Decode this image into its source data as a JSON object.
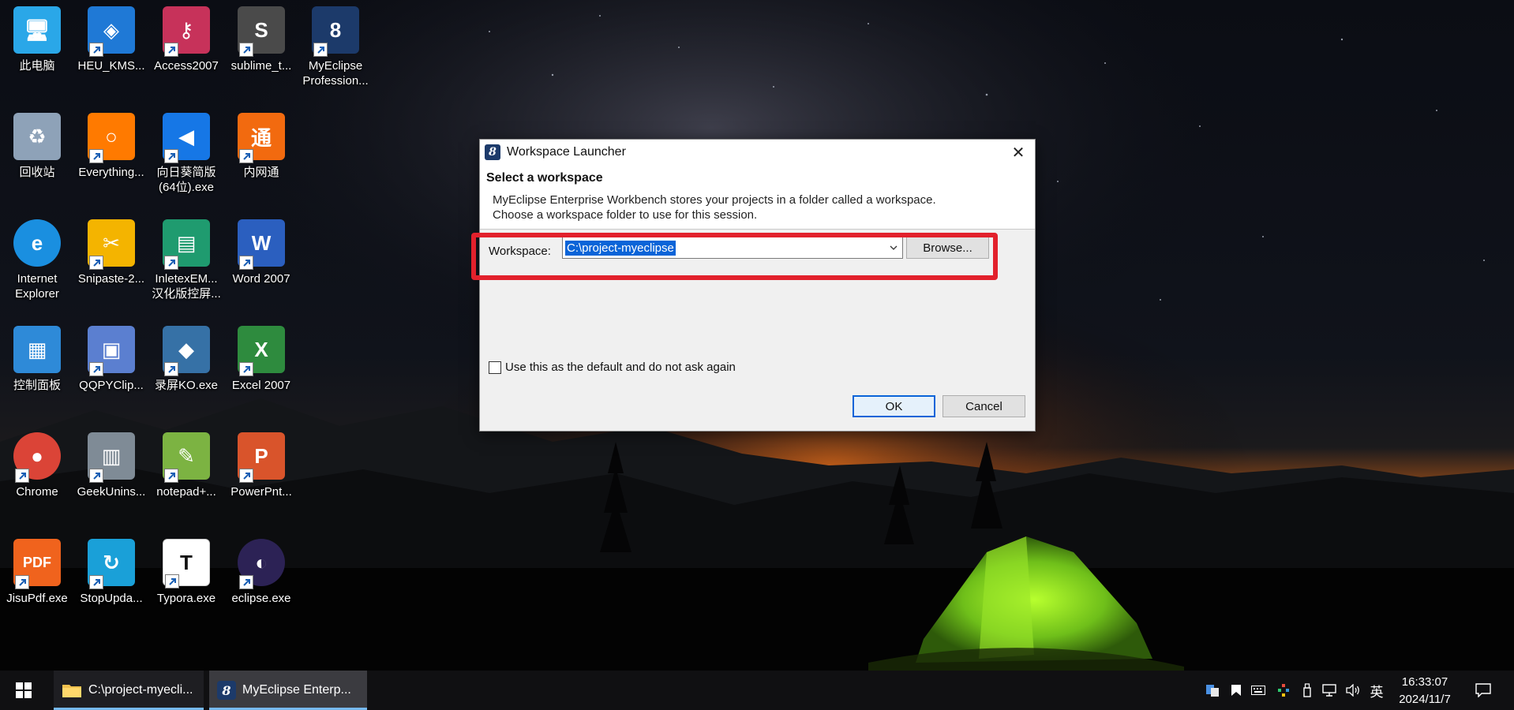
{
  "desktop": {
    "icons": [
      {
        "label": "此电脑",
        "icon": "computer-icon",
        "color": "#2aa7e8"
      },
      {
        "label": "HEU_KMS...",
        "icon": "cube-icon",
        "color": "#1f79d6"
      },
      {
        "label": "Access2007",
        "icon": "key-icon",
        "color": "#c7325a"
      },
      {
        "label": "sublime_t...",
        "icon": "sublime-icon",
        "color": "#4a4a4a"
      },
      {
        "label": "MyEclipse\nProfession...",
        "icon": "myeclipse-icon",
        "color": "#1c3a6a"
      },
      {
        "label": "回收站",
        "icon": "recycle-bin-icon",
        "color": "#8ea2b8"
      },
      {
        "label": "Everything...",
        "icon": "magnifier-icon",
        "color": "#ff7a00"
      },
      {
        "label": "向日葵简版\n(64位).exe",
        "icon": "sunflower-icon",
        "color": "#1677e6"
      },
      {
        "label": "内网通",
        "icon": "intranet-icon",
        "color": "#f26a0f"
      },
      {
        "label": "Internet\nExplorer",
        "icon": "ie-icon",
        "color": "#1a8fe0"
      },
      {
        "label": "Snipaste-2...",
        "icon": "snipaste-icon",
        "color": "#f4b400"
      },
      {
        "label": "InletexEM...\n汉化版控屏...",
        "icon": "inletex-icon",
        "color": "#1f9b6f"
      },
      {
        "label": "Word 2007",
        "icon": "word-icon",
        "color": "#2b5fbf"
      },
      {
        "label": "控制面板",
        "icon": "control-panel-icon",
        "color": "#2e8ad8"
      },
      {
        "label": "QQPYClip...",
        "icon": "clipboard-icon",
        "color": "#5b7fd0"
      },
      {
        "label": "录屏KO.exe",
        "icon": "python-icon",
        "color": "#3671a6"
      },
      {
        "label": "Excel 2007",
        "icon": "excel-icon",
        "color": "#2e8b3e"
      },
      {
        "label": "Chrome",
        "icon": "chrome-icon",
        "color": "#db4437"
      },
      {
        "label": "GeekUnins...",
        "icon": "trash-can-icon",
        "color": "#7f8b96"
      },
      {
        "label": "notepad+...",
        "icon": "notepad-plus-icon",
        "color": "#7cb342"
      },
      {
        "label": "PowerPnt...",
        "icon": "powerpoint-icon",
        "color": "#d9542b"
      },
      {
        "label": "JisuPdf.exe",
        "icon": "pdf-icon",
        "color": "#f0631d"
      },
      {
        "label": "StopUpda...",
        "icon": "stop-update-icon",
        "color": "#1aa0d8"
      },
      {
        "label": "Typora.exe",
        "icon": "typora-icon",
        "color": "#ffffff"
      },
      {
        "label": "eclipse.exe",
        "icon": "eclipse-icon",
        "color": "#2c2255"
      }
    ]
  },
  "dialog": {
    "title": "Workspace Launcher",
    "close_glyph": "✕",
    "heading": "Select a workspace",
    "description_line1": "MyEclipse Enterprise Workbench stores your projects in a folder called a workspace.",
    "description_line2": "Choose a workspace folder to use for this session.",
    "workspace_label": "Workspace:",
    "workspace_value": "C:\\project-myeclipse",
    "browse_label": "Browse...",
    "default_checkbox_label": "Use this as the default and do not ask again",
    "default_checked": false,
    "ok_label": "OK",
    "cancel_label": "Cancel",
    "highlight_color": "#e2212c"
  },
  "taskbar": {
    "items": [
      {
        "label": "C:\\project-myecli...",
        "icon": "folder-icon"
      },
      {
        "label": "MyEclipse Enterp...",
        "icon": "myeclipse-icon",
        "active": true
      }
    ],
    "tray": {
      "ime": "英",
      "time": "16:33:07",
      "date": "2024/11/7"
    }
  }
}
